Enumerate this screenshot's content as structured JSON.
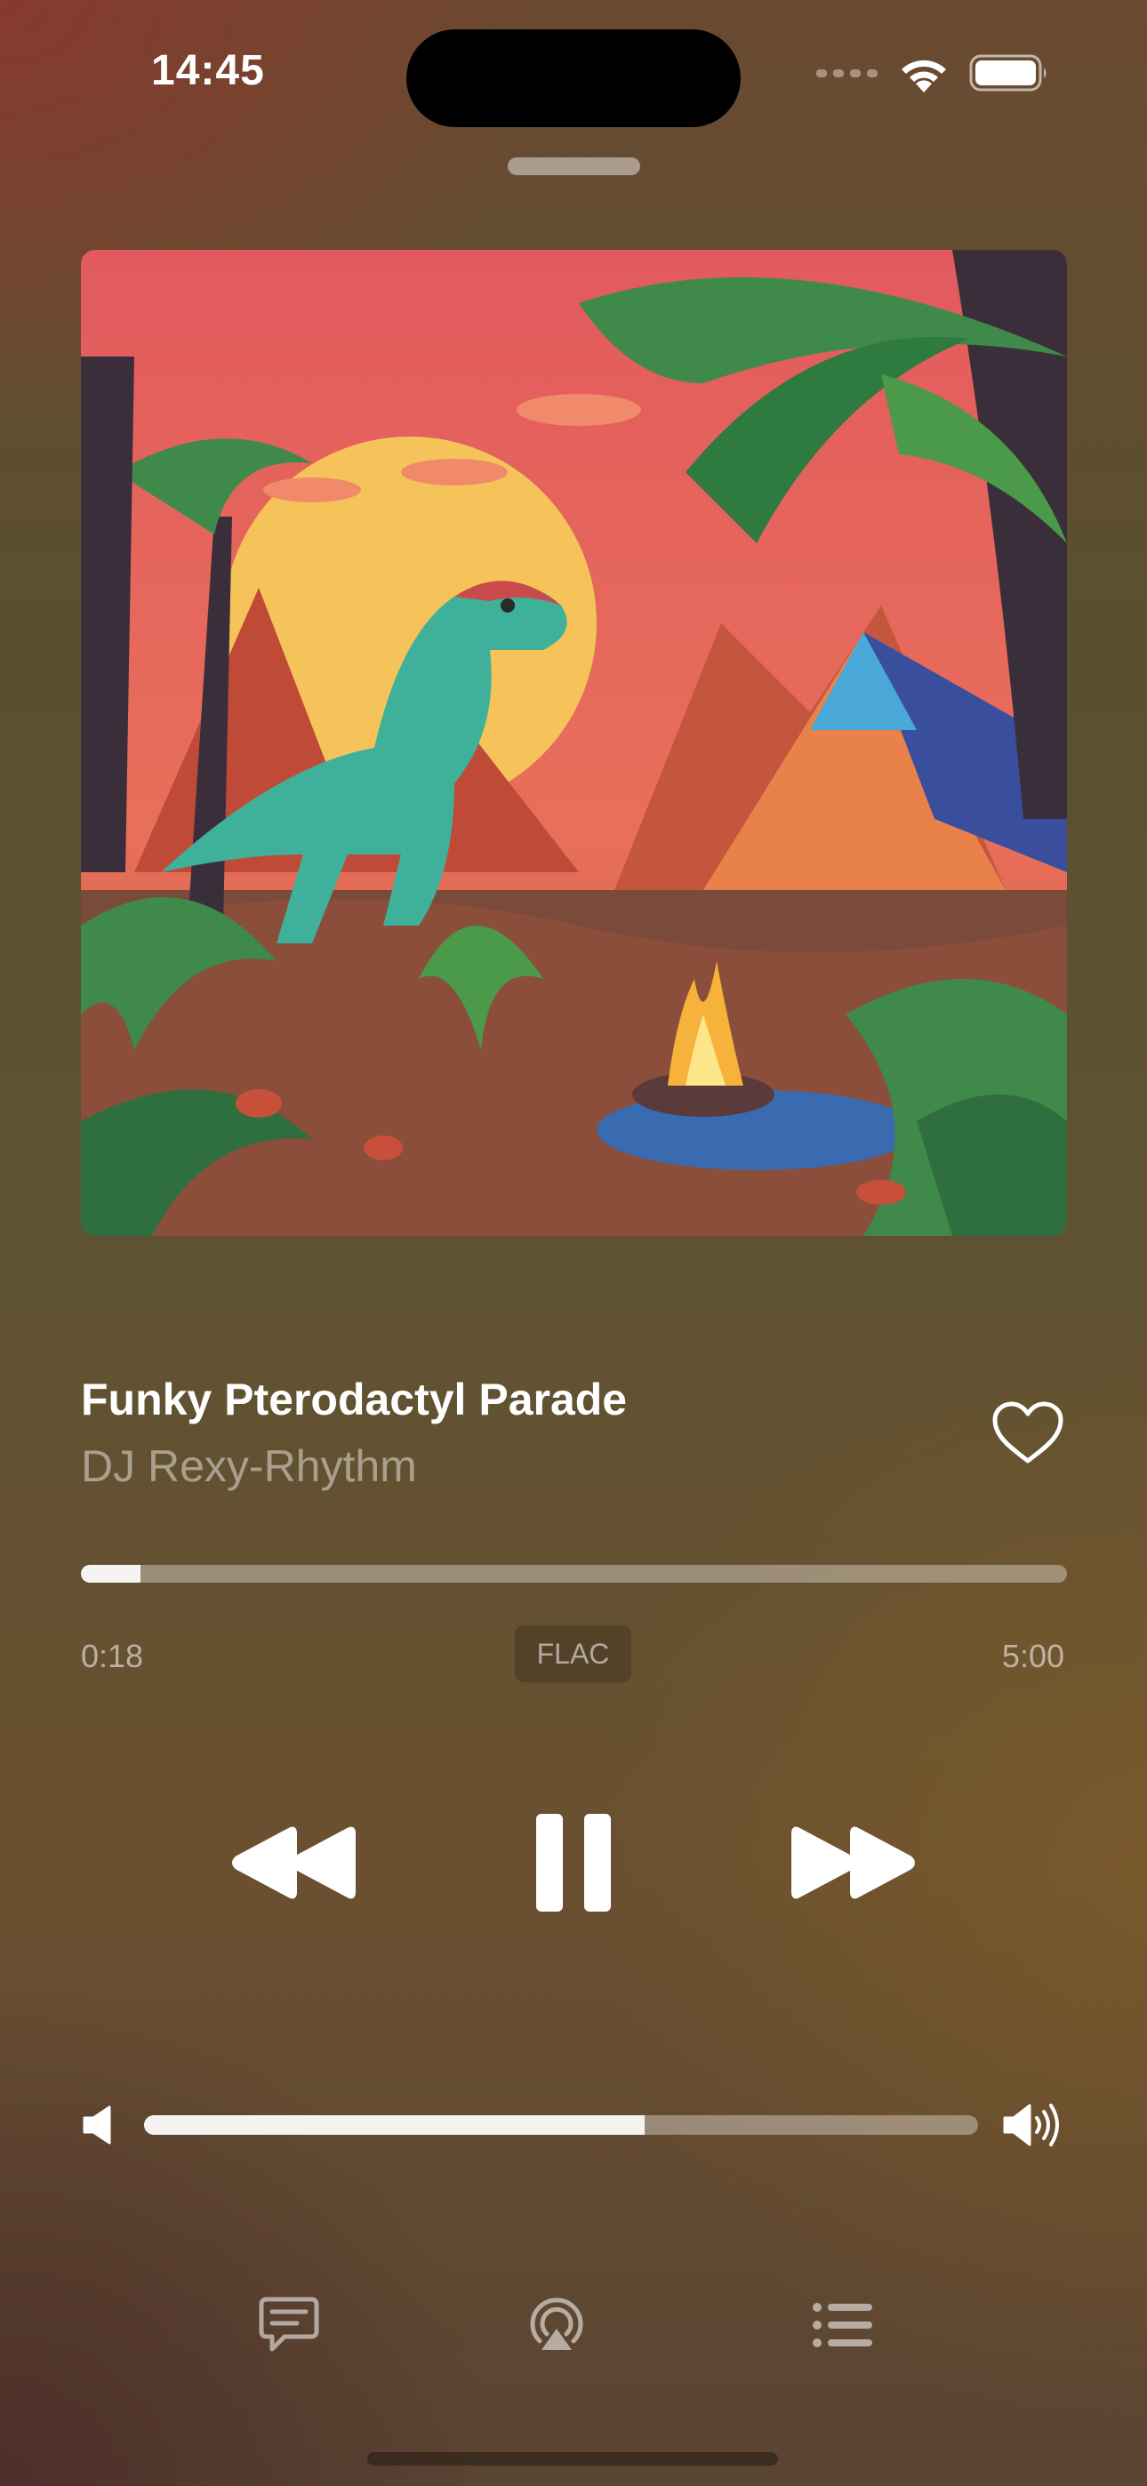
{
  "status_bar": {
    "time": "14:45"
  },
  "now_playing": {
    "title": "Funky Pterodactyl Parade",
    "artist": "DJ Rexy-Rhythm",
    "favorited": false
  },
  "playback": {
    "elapsed": "0:18",
    "total": "5:00",
    "progress_fraction": 0.06,
    "format_badge": "FLAC",
    "state": "playing"
  },
  "volume": {
    "level_fraction": 0.6
  },
  "icons": {
    "signal": "signal-dots-icon",
    "wifi": "wifi-icon",
    "battery": "battery-icon",
    "heart": "heart-icon",
    "rewind": "rewind-icon",
    "pause": "pause-icon",
    "fast_forward": "fast-forward-icon",
    "volume_low": "speaker-low-icon",
    "volume_high": "speaker-high-icon",
    "lyrics": "lyrics-bubble-icon",
    "airplay": "airplay-icon",
    "queue": "queue-list-icon"
  },
  "colors": {
    "accent": "#ffffff",
    "background_top": "#7a3a2e",
    "background_mid": "#5e5232"
  }
}
